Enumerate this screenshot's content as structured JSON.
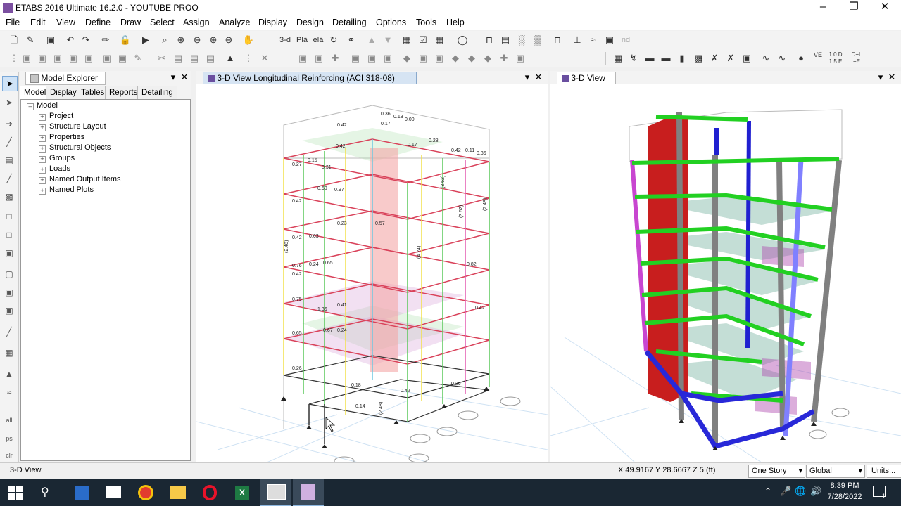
{
  "window": {
    "title": "ETABS 2016 Ultimate 16.2.0 - YOUTUBE PROO"
  },
  "menu": [
    "File",
    "Edit",
    "View",
    "Define",
    "Draw",
    "Select",
    "Assign",
    "Analyze",
    "Display",
    "Design",
    "Detailing",
    "Options",
    "Tools",
    "Help"
  ],
  "toolbar": {
    "threed_label": "3-d",
    "plan_label": "Plā",
    "elev_label": "elā",
    "nd_label": "nd",
    "combo1": "D+L",
    "combo2": "1.0 D 1.5 E",
    "combo3": "D+L +E",
    "ve_label": "VE"
  },
  "explorer": {
    "title": "Model Explorer",
    "tabs": [
      "Model",
      "Display",
      "Tables",
      "Reports",
      "Detailing"
    ],
    "root": "Model",
    "items": [
      "Project",
      "Structure Layout",
      "Properties",
      "Structural Objects",
      "Groups",
      "Loads",
      "Named Output Items",
      "Named Plots"
    ]
  },
  "view1": {
    "title": "3-D View  Longitudinal Reinforcing  (ACI 318-08)"
  },
  "view2": {
    "title": "3-D View"
  },
  "beam_labels": [
    "0.42",
    "0.36",
    "0.13",
    "0.00",
    "0.17",
    "0.42",
    "0.28",
    "0.17",
    "0.42",
    "0.11",
    "0.36",
    "0.27",
    "0.42",
    "0.15",
    "0.31",
    "0.60",
    "0.97",
    "0.42",
    "0.63",
    "0.23",
    "0.57",
    "0.42",
    "0.76",
    "0.24",
    "0.65",
    "0.82",
    "0.75",
    "1.36",
    "0.41",
    "0.42",
    "0.65",
    "0.67",
    "0.24",
    "0.26",
    "0.18",
    "0.42",
    "0.14",
    "0.26"
  ],
  "column_labels": [
    "(2.48)",
    "(3.62)",
    "(4.24)",
    "(2.48)",
    "(3.62)",
    "(2.48)"
  ],
  "status": {
    "left": "3-D View",
    "coords": "X 49.9167  Y 28.6667  Z 5 (ft)",
    "story_select": "One Story",
    "coord_select": "Global",
    "units_button": "Units..."
  },
  "taskbar": {
    "time": "8:39 PM",
    "date": "7/28/2022",
    "notif_count": "1"
  }
}
